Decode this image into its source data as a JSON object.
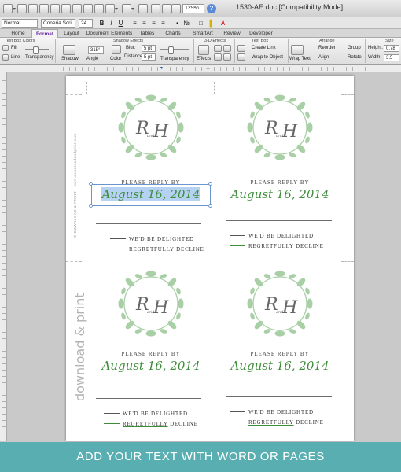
{
  "window": {
    "title": "1530-AE.doc [Compatibility Mode]",
    "zoom": "129%"
  },
  "fontbar": {
    "style": "Normal",
    "font": "Coneria Scri...",
    "size": "24"
  },
  "ribbon_tabs": [
    "Home",
    "Format",
    "Layout",
    "Document Elements",
    "Tables",
    "Charts",
    "SmartArt",
    "Review",
    "Developer"
  ],
  "active_tab": "Format",
  "ribbon": {
    "groups": {
      "text_box_colors": "Text Box Colors",
      "shadow_effects": "Shadow Effects",
      "effects_3d": "3-D Effects",
      "text_box": "Text Box",
      "arrange": "Arrange",
      "size": "Size"
    },
    "fill": "Fill",
    "line": "Line",
    "transparency": "Transparency",
    "shadow": "Shadow",
    "angle": "Angle",
    "angle_value": "315°",
    "color": "Color",
    "blur": "Blur:",
    "blur_value": "5 pt",
    "distance": "Distance:",
    "distance_value": "5 pt",
    "transparency2": "Transparency",
    "effects": "Effects",
    "create_link": "Create Link",
    "wrap_to_object": "Wrap to Object",
    "wrap_text": "Wrap Text",
    "reorder": "Reorder",
    "align": "Align",
    "group": "Group",
    "rotate": "Rotate",
    "height_label": "Height:",
    "height_value": "0.78",
    "width_label": "Width:",
    "width_value": "3.5"
  },
  "cards": [
    {
      "monogram_left": "R",
      "monogram_and": "and",
      "monogram_right": "H",
      "reply": "PLEASE REPLY BY",
      "date": "August 16, 2014",
      "accept": "WE'D BE DELIGHTED",
      "decline": "REGRETFULLY DECLINE"
    },
    {
      "monogram_left": "R",
      "monogram_and": "and",
      "monogram_right": "H",
      "reply": "PLEASE REPLY BY",
      "date": "August 16, 2014",
      "accept": "WE'D BE DELIGHTED",
      "decline_pre": "REGRETFULLY",
      "decline_post": " DECLINE"
    },
    {
      "monogram_left": "R",
      "monogram_and": "and",
      "monogram_right": "H",
      "reply": "PLEASE REPLY BY",
      "date": "August 16, 2014",
      "accept": "WE'D BE DELIGHTED",
      "decline_pre": "REGRETFULLY",
      "decline_post": " DECLINE"
    },
    {
      "monogram_left": "R",
      "monogram_and": "and",
      "monogram_right": "H",
      "reply": "PLEASE REPLY BY",
      "date": "August 16, 2014",
      "accept": "WE'D BE DELIGHTED",
      "decline_pre": "REGRETFULLY",
      "decline_post": " DECLINE"
    }
  ],
  "side_text_small": "© DOWNLOAD & PRINT · www.downloadandprint.com",
  "side_text_large": "download & print",
  "banner": "ADD YOUR TEXT WITH WORD OR PAGES",
  "colors": {
    "accent_green": "#3d8c3a",
    "wreath_green": "#a9cfa6",
    "banner_teal": "#58aeb0",
    "selection": "#b6d2f2"
  }
}
